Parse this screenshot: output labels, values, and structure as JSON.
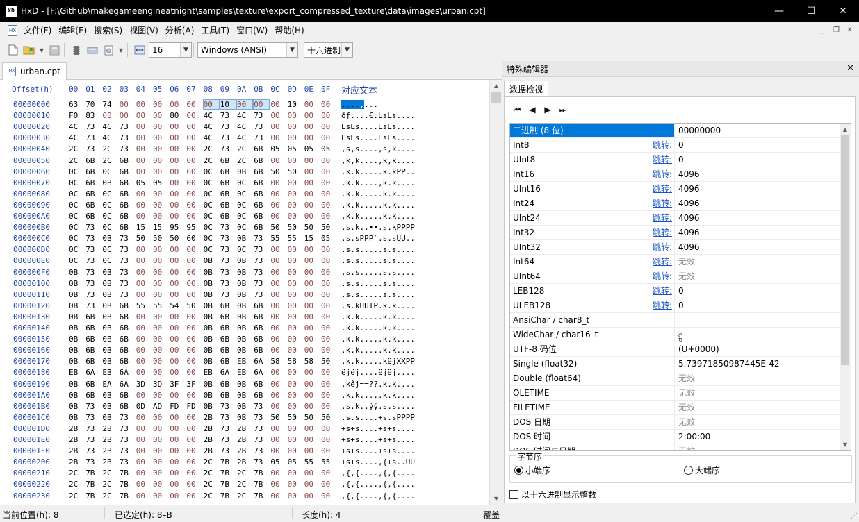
{
  "window": {
    "app": "HxD",
    "title": "HxD - [F:\\Github\\makegameengineatnight\\samples\\texture\\export_compressed_texture\\data\\images\\urban.cpt]",
    "min": "—",
    "max": "☐",
    "close": "✕"
  },
  "menu": [
    "文件(F)",
    "编辑(E)",
    "搜索(S)",
    "视图(V)",
    "分析(A)",
    "工具(T)",
    "窗口(W)",
    "帮助(H)"
  ],
  "toolbar": {
    "bytes_per_row": "16",
    "charset": "Windows (ANSI)",
    "offset_base": "十六进制"
  },
  "document_tab": "urban.cpt",
  "hex": {
    "offset_header": "Offset(h)",
    "columns": [
      "00",
      "01",
      "02",
      "03",
      "04",
      "05",
      "06",
      "07",
      "08",
      "09",
      "0A",
      "0B",
      "0C",
      "0D",
      "0E",
      "0F"
    ],
    "text_header": "对应文本",
    "rows": [
      {
        "o": "00000000",
        "b": "63 70 74 00 00 00 00 00 00 10 00 00 00 10 00 00",
        "t": "cpt.........,...."
      },
      {
        "o": "00000010",
        "b": "F0 83 00 00 00 00 80 00 4C 73 4C 73 00 00 00 00",
        "t": "ðƒ....€.LsLs...."
      },
      {
        "o": "00000020",
        "b": "4C 73 4C 73 00 00 00 00 4C 73 4C 73 00 00 00 00",
        "t": "LsLs....LsLs...."
      },
      {
        "o": "00000030",
        "b": "4C 73 4C 73 00 00 00 00 4C 73 4C 73 00 00 00 00",
        "t": "LsLs....LsLs...."
      },
      {
        "o": "00000040",
        "b": "2C 73 2C 73 00 00 00 00 2C 73 2C 6B 05 05 05 05",
        "t": ",s,s....,s,k...."
      },
      {
        "o": "00000050",
        "b": "2C 6B 2C 6B 00 00 00 00 2C 6B 2C 6B 00 00 00 00",
        "t": ",k,k....,k,k...."
      },
      {
        "o": "00000060",
        "b": "0C 6B 0C 6B 00 00 00 00 0C 6B 0B 6B 50 50 00 00",
        "t": ".k.k.....k.kPP.."
      },
      {
        "o": "00000070",
        "b": "0C 6B 0B 6B 05 05 00 00 0C 6B 0C 6B 00 00 00 00",
        "t": ".k.k....,k.k...."
      },
      {
        "o": "00000080",
        "b": "0C 6B 0C 6B 00 00 00 00 0C 6B 0C 6B 00 00 00 00",
        "t": ".k.k.....k.k...."
      },
      {
        "o": "00000090",
        "b": "0C 6B 0C 6B 00 00 00 00 0C 6B 0C 6B 00 00 00 00",
        "t": ".k.k.....k.k...."
      },
      {
        "o": "000000A0",
        "b": "0C 6B 0C 6B 00 00 00 00 0C 6B 0C 6B 00 00 00 00",
        "t": ".k.k.....k.k...."
      },
      {
        "o": "000000B0",
        "b": "0C 73 0C 6B 15 15 95 95 0C 73 0C 6B 50 50 50 50",
        "t": ".s.k..••.s.kPPPP"
      },
      {
        "o": "000000C0",
        "b": "0C 73 0B 73 50 50 50 60 0C 73 0B 73 55 55 15 05",
        "t": ".s.sPPP`.s.sUU.."
      },
      {
        "o": "000000D0",
        "b": "0C 73 0C 73 00 00 00 00 0C 73 0C 73 00 00 00 00",
        "t": ".s.s.....s.s...."
      },
      {
        "o": "000000E0",
        "b": "0C 73 0C 73 00 00 00 00 0B 73 0B 73 00 00 00 00",
        "t": ".s.s.....s.s...."
      },
      {
        "o": "000000F0",
        "b": "0B 73 0B 73 00 00 00 00 0B 73 0B 73 00 00 00 00",
        "t": ".s.s.....s.s...."
      },
      {
        "o": "00000100",
        "b": "0B 73 0B 73 00 00 00 00 0B 73 0B 73 00 00 00 00",
        "t": ".s.s.....s.s...."
      },
      {
        "o": "00000110",
        "b": "0B 73 0B 73 00 00 00 00 0B 73 0B 73 00 00 00 00",
        "t": ".s.s.....s.s...."
      },
      {
        "o": "00000120",
        "b": "0B 73 0B 6B 55 55 54 50 0B 6B 0B 6B 00 00 00 00",
        "t": ".s.kUUTP.k.k...."
      },
      {
        "o": "00000130",
        "b": "0B 6B 0B 6B 00 00 00 00 0B 6B 0B 6B 00 00 00 00",
        "t": ".k.k.....k.k...."
      },
      {
        "o": "00000140",
        "b": "0B 6B 0B 6B 00 00 00 00 0B 6B 0B 6B 00 00 00 00",
        "t": ".k.k.....k.k...."
      },
      {
        "o": "00000150",
        "b": "0B 6B 0B 6B 00 00 00 00 0B 6B 0B 6B 00 00 00 00",
        "t": ".k.k.....k.k...."
      },
      {
        "o": "00000160",
        "b": "0B 6B 0B 6B 00 00 00 00 0B 6B 0B 6B 00 00 00 00",
        "t": ".k.k.....k.k...."
      },
      {
        "o": "00000170",
        "b": "0B 6B 0B 6B 00 00 00 00 0B 6B EB 6A 58 58 58 50",
        "t": ".k.k.....këjXXPP"
      },
      {
        "o": "00000180",
        "b": "EB 6A EB 6A 00 00 00 00 EB 6A EB 6A 00 00 00 00",
        "t": "ëjëj....ëjëj...."
      },
      {
        "o": "00000190",
        "b": "0B 6B EA 6A 3D 3D 3F 3F 0B 6B 0B 6B 00 00 00 00",
        "t": ".kêj==??.k.k...."
      },
      {
        "o": "000001A0",
        "b": "0B 6B 0B 6B 00 00 00 00 0B 6B 0B 6B 00 00 00 00",
        "t": ".k.k.....k.k...."
      },
      {
        "o": "000001B0",
        "b": "0B 73 0B 6B 0D AD FD FD 0B 73 0B 73 00 00 00 00",
        "t": ".s.k..ýý.s.s...."
      },
      {
        "o": "000001C0",
        "b": "0B 73 0B 73 00 00 00 00 2B 73 0B 73 50 50 50 50",
        "t": ".s.s....+s.sPPPP"
      },
      {
        "o": "000001D0",
        "b": "2B 73 2B 73 00 00 00 00 2B 73 2B 73 00 00 00 00",
        "t": "+s+s....+s+s...."
      },
      {
        "o": "000001E0",
        "b": "2B 73 2B 73 00 00 00 00 2B 73 2B 73 00 00 00 00",
        "t": "+s+s....+s+s...."
      },
      {
        "o": "000001F0",
        "b": "2B 73 2B 73 00 00 00 00 2B 73 2B 73 00 00 00 00",
        "t": "+s+s....+s+s...."
      },
      {
        "o": "00000200",
        "b": "2B 73 2B 73 00 00 00 00 2C 7B 2B 73 05 05 55 55",
        "t": "+s+s....,{+s..UU"
      },
      {
        "o": "00000210",
        "b": "2C 7B 2C 7B 00 00 00 00 2C 7B 2C 7B 00 00 00 00",
        "t": ",{,{....,{,{...."
      },
      {
        "o": "00000220",
        "b": "2C 7B 2C 7B 00 00 00 00 2C 7B 2C 7B 00 00 00 00",
        "t": ",{,{....,{,{...."
      },
      {
        "o": "00000230",
        "b": "2C 7B 2C 7B 00 00 00 00 2C 7B 2C 7B 00 00 00 00",
        "t": ",{,{....,{,{...."
      }
    ]
  },
  "inspector": {
    "panel_title": "特殊编辑器",
    "close": "✕",
    "tab": "数据检视",
    "jump_label": "跳转:",
    "rows": [
      {
        "name": "二进制 (8 位)",
        "value": "00000000",
        "jump": false,
        "na": false
      },
      {
        "name": "Int8",
        "value": "0",
        "jump": true,
        "na": false
      },
      {
        "name": "UInt8",
        "value": "0",
        "jump": true,
        "na": false
      },
      {
        "name": "Int16",
        "value": "4096",
        "jump": true,
        "na": false
      },
      {
        "name": "UInt16",
        "value": "4096",
        "jump": true,
        "na": false
      },
      {
        "name": "Int24",
        "value": "4096",
        "jump": true,
        "na": false
      },
      {
        "name": "UInt24",
        "value": "4096",
        "jump": true,
        "na": false
      },
      {
        "name": "Int32",
        "value": "4096",
        "jump": true,
        "na": false
      },
      {
        "name": "UInt32",
        "value": "4096",
        "jump": true,
        "na": false
      },
      {
        "name": "Int64",
        "value": "无效",
        "jump": true,
        "na": true
      },
      {
        "name": "UInt64",
        "value": "无效",
        "jump": true,
        "na": true
      },
      {
        "name": "LEB128",
        "value": "0",
        "jump": true,
        "na": false
      },
      {
        "name": "ULEB128",
        "value": "0",
        "jump": true,
        "na": false
      },
      {
        "name": "AnsiChar / char8_t",
        "value": "",
        "jump": false,
        "na": false
      },
      {
        "name": "WideChar / char16_t",
        "value": "ဠ",
        "jump": false,
        "na": false
      },
      {
        "name": "UTF-8 码位",
        "value": " (U+0000)",
        "jump": false,
        "na": false
      },
      {
        "name": "Single (float32)",
        "value": "5.73971850987445E-42",
        "jump": false,
        "na": false
      },
      {
        "name": "Double (float64)",
        "value": "无效",
        "jump": false,
        "na": true
      },
      {
        "name": "OLETIME",
        "value": "无效",
        "jump": false,
        "na": true
      },
      {
        "name": "FILETIME",
        "value": "无效",
        "jump": false,
        "na": true
      },
      {
        "name": "DOS 日期",
        "value": "无效",
        "jump": false,
        "na": true
      },
      {
        "name": "DOS 时间",
        "value": "2:00:00",
        "jump": false,
        "na": false
      },
      {
        "name": "DOS 时间与日期",
        "value": "无效",
        "jump": false,
        "na": true
      }
    ],
    "byte_order_title": "字节序",
    "little_endian": "小端序",
    "big_endian": "大端序",
    "hex_ints": "以十六进制显示整数"
  },
  "status": {
    "position": "当前位置(h):  8",
    "selection": "已选定(h):  8–B",
    "length": "长度(h):  4",
    "mode": "覆盖"
  },
  "colors": {
    "accent": "#0078d7",
    "offset_blue": "#1f43a8",
    "zero_byte": "#8b4a4a"
  },
  "icons": [
    "new-file-icon",
    "open-file-icon",
    "save-icon",
    "ram-icon",
    "disk-icon",
    "disk-image-icon",
    "bytes-per-row-icon",
    "first-icon",
    "prev-icon",
    "next-icon",
    "last-icon"
  ]
}
